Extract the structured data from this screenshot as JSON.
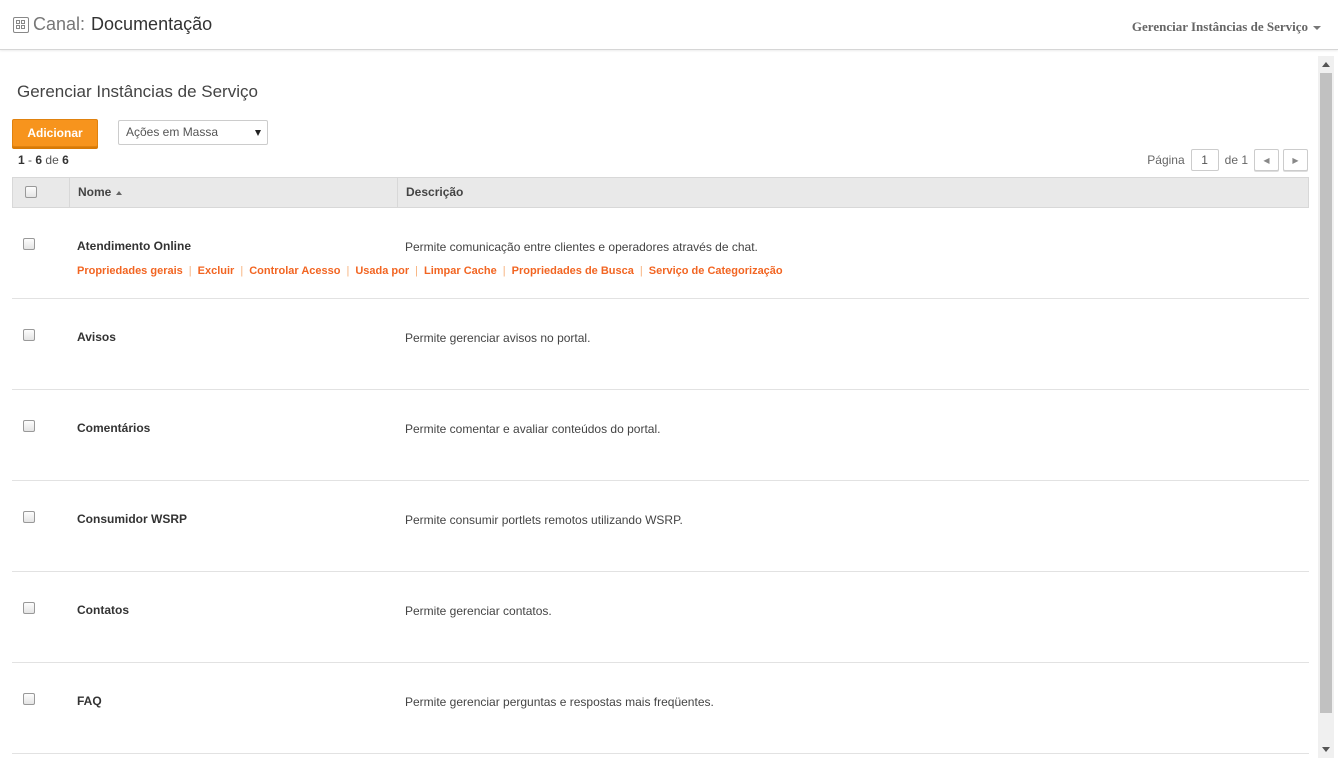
{
  "header": {
    "canal_label": "Canal",
    "canal_sep": ":",
    "title": "Documentação",
    "manage_link": "Gerenciar Instâncias de Serviço"
  },
  "page": {
    "title": "Gerenciar Instâncias de Serviço",
    "add_button": "Adicionar",
    "bulk_actions": "Ações em Massa",
    "count": {
      "start": "1",
      "dash": "-",
      "end": "6",
      "of": "de",
      "total": "6"
    },
    "pager": {
      "label": "Página",
      "value": "1",
      "of_text": "de 1"
    }
  },
  "table": {
    "headers": {
      "name": "Nome",
      "description": "Descrição"
    },
    "rows": [
      {
        "name": "Atendimento Online",
        "description": "Permite comunicação entre clientes e operadores através de chat.",
        "actions": [
          "Propriedades gerais",
          "Excluir",
          "Controlar Acesso",
          "Usada por",
          "Limpar Cache",
          "Propriedades de Busca",
          "Serviço de Categorização"
        ]
      },
      {
        "name": "Avisos",
        "description": "Permite gerenciar avisos no portal."
      },
      {
        "name": "Comentários",
        "description": "Permite comentar e avaliar conteúdos do portal."
      },
      {
        "name": "Consumidor WSRP",
        "description": "Permite consumir portlets remotos utilizando WSRP."
      },
      {
        "name": "Contatos",
        "description": "Permite gerenciar contatos."
      },
      {
        "name": "FAQ",
        "description": "Permite gerenciar perguntas e respostas mais freqüentes."
      }
    ]
  },
  "colors": {
    "accent": "#f7941d",
    "action_link": "#f26522"
  }
}
